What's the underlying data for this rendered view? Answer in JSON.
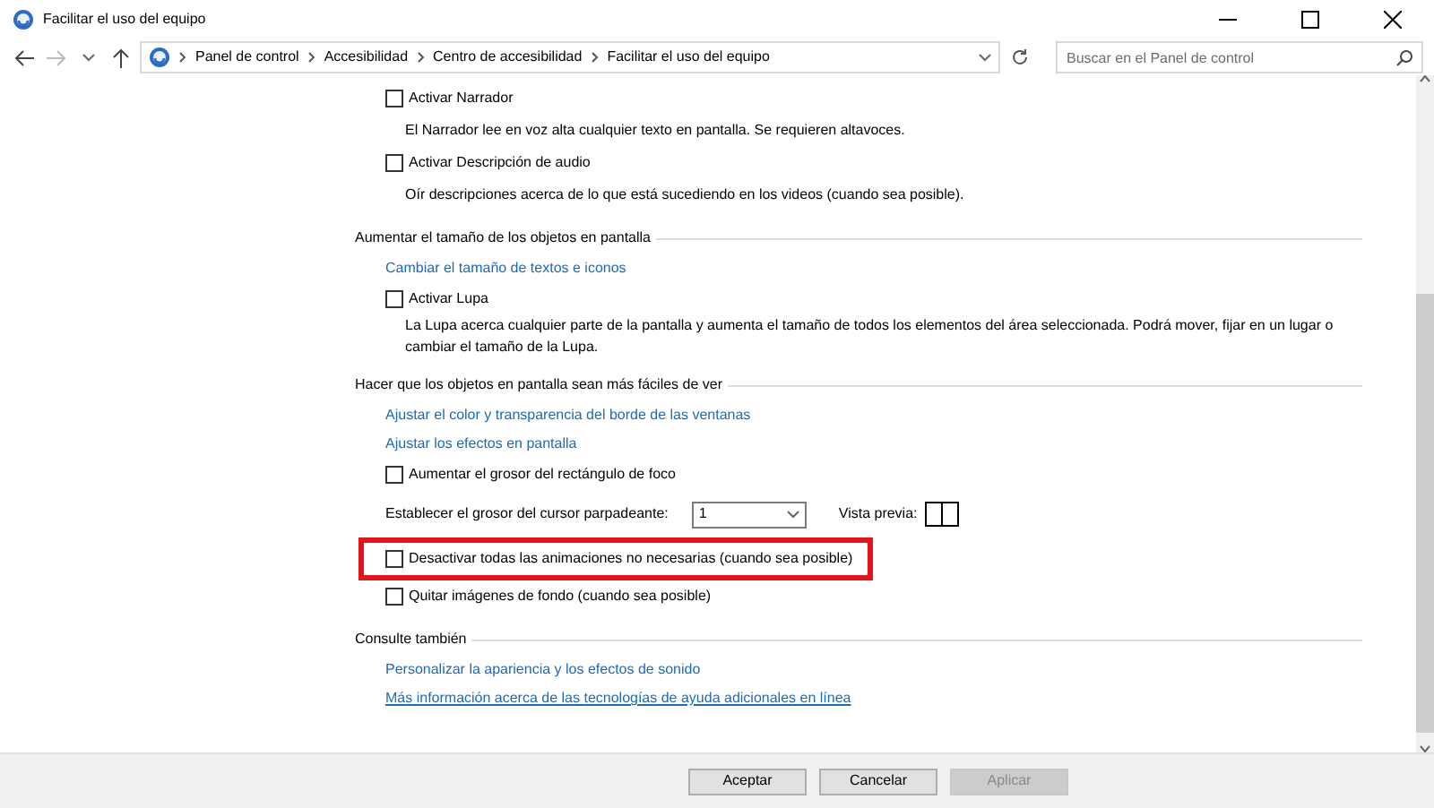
{
  "window": {
    "title": "Facilitar el uso del equipo"
  },
  "address_bar": {
    "crumbs": [
      "Panel de control",
      "Accesibilidad",
      "Centro de accesibilidad",
      "Facilitar el uso del equipo"
    ]
  },
  "search": {
    "placeholder": "Buscar en el Panel de control"
  },
  "content": [
    {
      "kind": "checkbox",
      "label": "Activar Narrador",
      "checked": false,
      "highlighted": false
    },
    {
      "kind": "description",
      "text": "El Narrador lee en voz alta cualquier texto en pantalla. Se requieren altavoces."
    },
    {
      "kind": "checkbox",
      "label": "Activar Descripción de audio",
      "checked": false,
      "highlighted": false
    },
    {
      "kind": "description",
      "text": "Oír descripciones acerca de lo que está sucediendo en los videos (cuando sea posible)."
    },
    {
      "kind": "heading",
      "text": "Aumentar el tamaño de los objetos en pantalla"
    },
    {
      "kind": "link",
      "text": "Cambiar el tamaño de textos e iconos",
      "underlined": false
    },
    {
      "kind": "checkbox",
      "label": "Activar Lupa",
      "checked": false,
      "highlighted": false
    },
    {
      "kind": "description",
      "text": "La Lupa acerca cualquier parte de la pantalla y aumenta el tamaño de todos los elementos del área seleccionada. Podrá mover, fijar en un lugar o cambiar el tamaño de la Lupa."
    },
    {
      "kind": "heading",
      "text": "Hacer que los objetos en pantalla sean más fáciles de ver"
    },
    {
      "kind": "link",
      "text": "Ajustar el color y transparencia del borde de las ventanas",
      "underlined": false
    },
    {
      "kind": "link",
      "text": "Ajustar los efectos en pantalla",
      "underlined": false
    },
    {
      "kind": "checkbox",
      "label": "Aumentar el grosor del rectángulo de foco",
      "checked": false,
      "highlighted": false
    },
    {
      "kind": "select",
      "label": "Establecer el grosor del cursor parpadeante:",
      "value": "1",
      "preview_label": "Vista previa:"
    },
    {
      "kind": "checkbox",
      "label": "Desactivar todas las animaciones no necesarias (cuando sea posible)",
      "checked": false,
      "highlighted": true
    },
    {
      "kind": "checkbox",
      "label": "Quitar imágenes de fondo (cuando sea posible)",
      "checked": false,
      "highlighted": false
    },
    {
      "kind": "heading",
      "text": "Consulte también"
    },
    {
      "kind": "link",
      "text": "Personalizar la apariencia y los efectos de sonido",
      "underlined": false
    },
    {
      "kind": "link",
      "text": "Más información acerca de las tecnologías de ayuda adicionales en línea",
      "underlined": true
    }
  ],
  "buttons": [
    {
      "label": "Aceptar",
      "disabled": false
    },
    {
      "label": "Cancelar",
      "disabled": false
    },
    {
      "label": "Aplicar",
      "disabled": true
    }
  ]
}
